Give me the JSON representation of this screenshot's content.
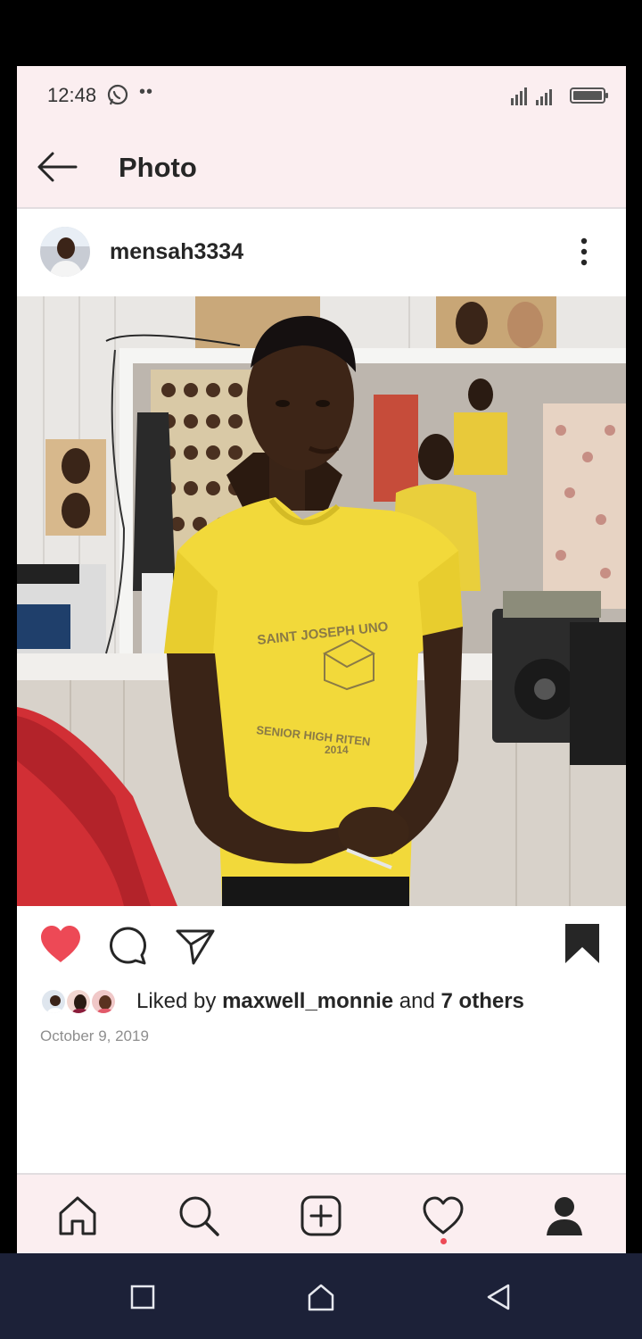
{
  "status_bar": {
    "time": "12:48",
    "notification_icons": [
      "whatsapp-icon",
      "more-dots-icon"
    ],
    "right_icons": [
      "signal-icon",
      "battery-icon"
    ]
  },
  "header": {
    "title": "Photo",
    "back_icon": "back-arrow-icon"
  },
  "post": {
    "username": "mensah3334",
    "liked_by_prefix": "Liked by ",
    "liked_by_user": "maxwell_monnie",
    "liked_by_join": " and ",
    "liked_by_others": "7 others",
    "date": "October 9, 2019",
    "liked": true,
    "saved": true,
    "actions": [
      "heart-icon",
      "comment-icon",
      "share-icon",
      "bookmark-icon"
    ]
  },
  "bottom_nav": [
    "home-icon",
    "search-icon",
    "add-post-icon",
    "activity-icon",
    "profile-icon"
  ],
  "system_nav": [
    "recents-icon",
    "home-icon",
    "back-icon"
  ],
  "colors": {
    "like_red": "#ed4956",
    "shirt_yellow": "#f2d93a",
    "status_bg": "#fbeef0",
    "system_nav_bg": "#1c2138"
  }
}
